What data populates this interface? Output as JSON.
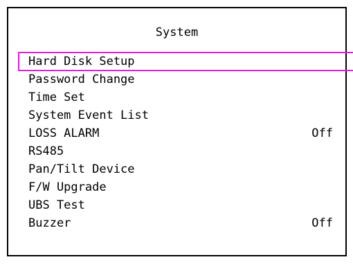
{
  "title": "System",
  "accent_color": "#e020d8",
  "menu": {
    "selected_index": 0,
    "items": [
      {
        "label": "Hard Disk Setup",
        "value": ""
      },
      {
        "label": "Password Change",
        "value": ""
      },
      {
        "label": "Time Set",
        "value": ""
      },
      {
        "label": "System Event List",
        "value": ""
      },
      {
        "label": "LOSS ALARM",
        "value": "Off"
      },
      {
        "label": "RS485",
        "value": ""
      },
      {
        "label": "Pan/Tilt Device",
        "value": ""
      },
      {
        "label": "F/W Upgrade",
        "value": ""
      },
      {
        "label": "UBS Test",
        "value": ""
      },
      {
        "label": "Buzzer",
        "value": "Off"
      }
    ]
  }
}
